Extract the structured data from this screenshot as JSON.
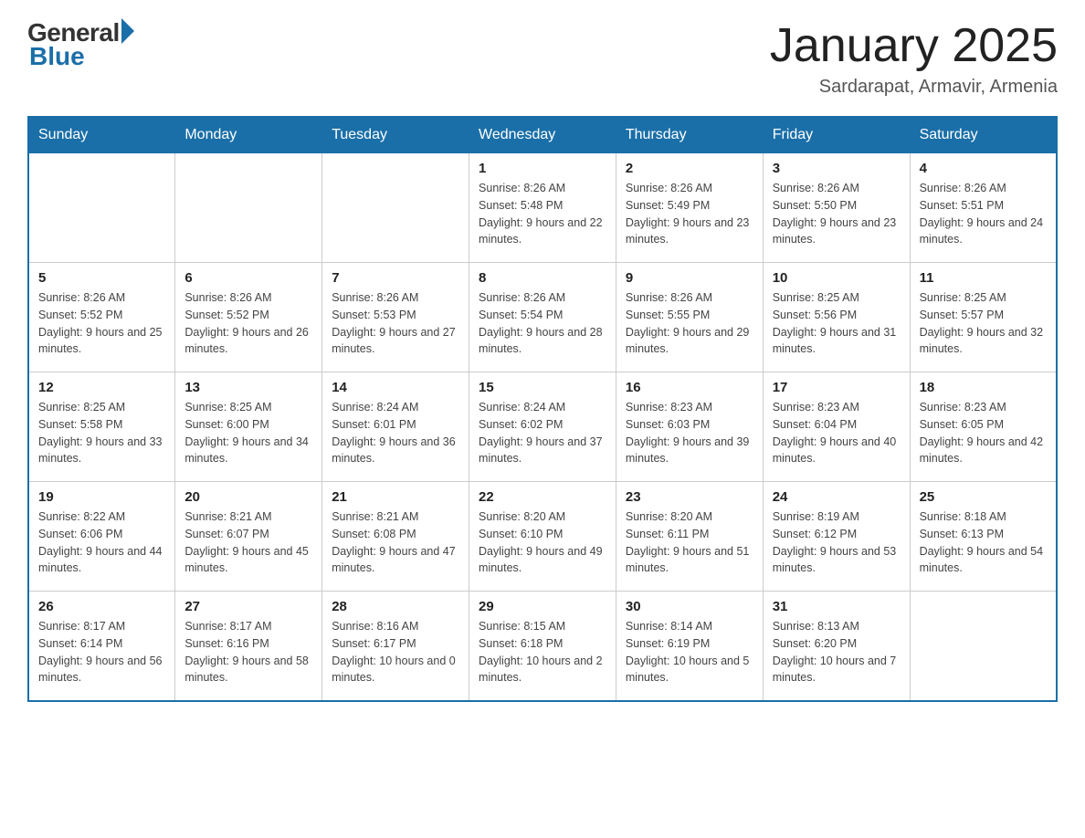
{
  "logo": {
    "general": "General",
    "blue": "Blue"
  },
  "title": "January 2025",
  "subtitle": "Sardarapat, Armavir, Armenia",
  "columns": [
    "Sunday",
    "Monday",
    "Tuesday",
    "Wednesday",
    "Thursday",
    "Friday",
    "Saturday"
  ],
  "weeks": [
    [
      {
        "day": "",
        "info": ""
      },
      {
        "day": "",
        "info": ""
      },
      {
        "day": "",
        "info": ""
      },
      {
        "day": "1",
        "info": "Sunrise: 8:26 AM\nSunset: 5:48 PM\nDaylight: 9 hours\nand 22 minutes."
      },
      {
        "day": "2",
        "info": "Sunrise: 8:26 AM\nSunset: 5:49 PM\nDaylight: 9 hours\nand 23 minutes."
      },
      {
        "day": "3",
        "info": "Sunrise: 8:26 AM\nSunset: 5:50 PM\nDaylight: 9 hours\nand 23 minutes."
      },
      {
        "day": "4",
        "info": "Sunrise: 8:26 AM\nSunset: 5:51 PM\nDaylight: 9 hours\nand 24 minutes."
      }
    ],
    [
      {
        "day": "5",
        "info": "Sunrise: 8:26 AM\nSunset: 5:52 PM\nDaylight: 9 hours\nand 25 minutes."
      },
      {
        "day": "6",
        "info": "Sunrise: 8:26 AM\nSunset: 5:52 PM\nDaylight: 9 hours\nand 26 minutes."
      },
      {
        "day": "7",
        "info": "Sunrise: 8:26 AM\nSunset: 5:53 PM\nDaylight: 9 hours\nand 27 minutes."
      },
      {
        "day": "8",
        "info": "Sunrise: 8:26 AM\nSunset: 5:54 PM\nDaylight: 9 hours\nand 28 minutes."
      },
      {
        "day": "9",
        "info": "Sunrise: 8:26 AM\nSunset: 5:55 PM\nDaylight: 9 hours\nand 29 minutes."
      },
      {
        "day": "10",
        "info": "Sunrise: 8:25 AM\nSunset: 5:56 PM\nDaylight: 9 hours\nand 31 minutes."
      },
      {
        "day": "11",
        "info": "Sunrise: 8:25 AM\nSunset: 5:57 PM\nDaylight: 9 hours\nand 32 minutes."
      }
    ],
    [
      {
        "day": "12",
        "info": "Sunrise: 8:25 AM\nSunset: 5:58 PM\nDaylight: 9 hours\nand 33 minutes."
      },
      {
        "day": "13",
        "info": "Sunrise: 8:25 AM\nSunset: 6:00 PM\nDaylight: 9 hours\nand 34 minutes."
      },
      {
        "day": "14",
        "info": "Sunrise: 8:24 AM\nSunset: 6:01 PM\nDaylight: 9 hours\nand 36 minutes."
      },
      {
        "day": "15",
        "info": "Sunrise: 8:24 AM\nSunset: 6:02 PM\nDaylight: 9 hours\nand 37 minutes."
      },
      {
        "day": "16",
        "info": "Sunrise: 8:23 AM\nSunset: 6:03 PM\nDaylight: 9 hours\nand 39 minutes."
      },
      {
        "day": "17",
        "info": "Sunrise: 8:23 AM\nSunset: 6:04 PM\nDaylight: 9 hours\nand 40 minutes."
      },
      {
        "day": "18",
        "info": "Sunrise: 8:23 AM\nSunset: 6:05 PM\nDaylight: 9 hours\nand 42 minutes."
      }
    ],
    [
      {
        "day": "19",
        "info": "Sunrise: 8:22 AM\nSunset: 6:06 PM\nDaylight: 9 hours\nand 44 minutes."
      },
      {
        "day": "20",
        "info": "Sunrise: 8:21 AM\nSunset: 6:07 PM\nDaylight: 9 hours\nand 45 minutes."
      },
      {
        "day": "21",
        "info": "Sunrise: 8:21 AM\nSunset: 6:08 PM\nDaylight: 9 hours\nand 47 minutes."
      },
      {
        "day": "22",
        "info": "Sunrise: 8:20 AM\nSunset: 6:10 PM\nDaylight: 9 hours\nand 49 minutes."
      },
      {
        "day": "23",
        "info": "Sunrise: 8:20 AM\nSunset: 6:11 PM\nDaylight: 9 hours\nand 51 minutes."
      },
      {
        "day": "24",
        "info": "Sunrise: 8:19 AM\nSunset: 6:12 PM\nDaylight: 9 hours\nand 53 minutes."
      },
      {
        "day": "25",
        "info": "Sunrise: 8:18 AM\nSunset: 6:13 PM\nDaylight: 9 hours\nand 54 minutes."
      }
    ],
    [
      {
        "day": "26",
        "info": "Sunrise: 8:17 AM\nSunset: 6:14 PM\nDaylight: 9 hours\nand 56 minutes."
      },
      {
        "day": "27",
        "info": "Sunrise: 8:17 AM\nSunset: 6:16 PM\nDaylight: 9 hours\nand 58 minutes."
      },
      {
        "day": "28",
        "info": "Sunrise: 8:16 AM\nSunset: 6:17 PM\nDaylight: 10 hours\nand 0 minutes."
      },
      {
        "day": "29",
        "info": "Sunrise: 8:15 AM\nSunset: 6:18 PM\nDaylight: 10 hours\nand 2 minutes."
      },
      {
        "day": "30",
        "info": "Sunrise: 8:14 AM\nSunset: 6:19 PM\nDaylight: 10 hours\nand 5 minutes."
      },
      {
        "day": "31",
        "info": "Sunrise: 8:13 AM\nSunset: 6:20 PM\nDaylight: 10 hours\nand 7 minutes."
      },
      {
        "day": "",
        "info": ""
      }
    ]
  ]
}
